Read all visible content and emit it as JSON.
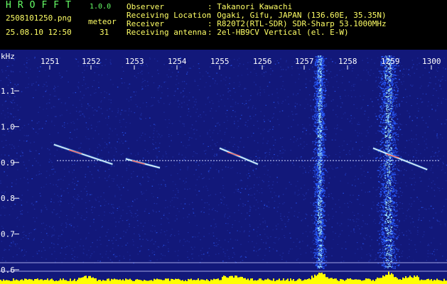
{
  "header": {
    "brand": "HROFFT",
    "version": "1.0.0",
    "filename": "2508101250.png",
    "meteor_label": "meteor",
    "timestamp": "25.08.10 12:50",
    "meteor_count": "31",
    "info": [
      {
        "label": "Observer",
        "value": ": Takanori Kawachi"
      },
      {
        "label": "Receiving Location",
        "value": ": Ogaki, Gifu, JAPAN (136.60E, 35.35N)"
      },
      {
        "label": "Receiver",
        "value": ": R820T2(RTL-SDR) SDR-Sharp 53.1000MHz"
      },
      {
        "label": "Receiving antenna",
        "value": ": 2el-HB9CV Vertical (el. E-W)"
      }
    ]
  },
  "chart_data": {
    "type": "heatmap",
    "ylabel": "kHz",
    "x_ticks": [
      "1251",
      "1252",
      "1253",
      "1254",
      "1255",
      "1256",
      "1257",
      "1258",
      "1259",
      "1300"
    ],
    "y_ticks": [
      "1.1",
      "1.0",
      "0.9",
      "0.8",
      "0.7",
      "0.6"
    ],
    "ylim": [
      0.58,
      1.2
    ],
    "carrier_khz": 0.905,
    "meteor_echoes": [
      {
        "t_start": 1251.1,
        "t_end": 1252.5,
        "f_start": 0.95,
        "f_end": 0.895
      },
      {
        "t_start": 1252.8,
        "t_end": 1253.6,
        "f_start": 0.91,
        "f_end": 0.885
      },
      {
        "t_start": 1255.0,
        "t_end": 1255.9,
        "f_start": 0.94,
        "f_end": 0.895
      },
      {
        "t_start": 1258.6,
        "t_end": 1259.9,
        "f_start": 0.94,
        "f_end": 0.88
      }
    ],
    "noise_bands": [
      {
        "t_center": 1257.35,
        "half_width": 0.12
      },
      {
        "t_center": 1258.95,
        "half_width": 0.2
      }
    ],
    "colors": {
      "background": "#12187a",
      "noise": "#2a5cff",
      "noise_hot": "#aaf2ff",
      "echo": "#ffffff",
      "echo_hot": "#ff4444",
      "carrier": "#d0d8ff",
      "level_bar": "#ffff00",
      "axis_text": "#ffffff"
    }
  }
}
